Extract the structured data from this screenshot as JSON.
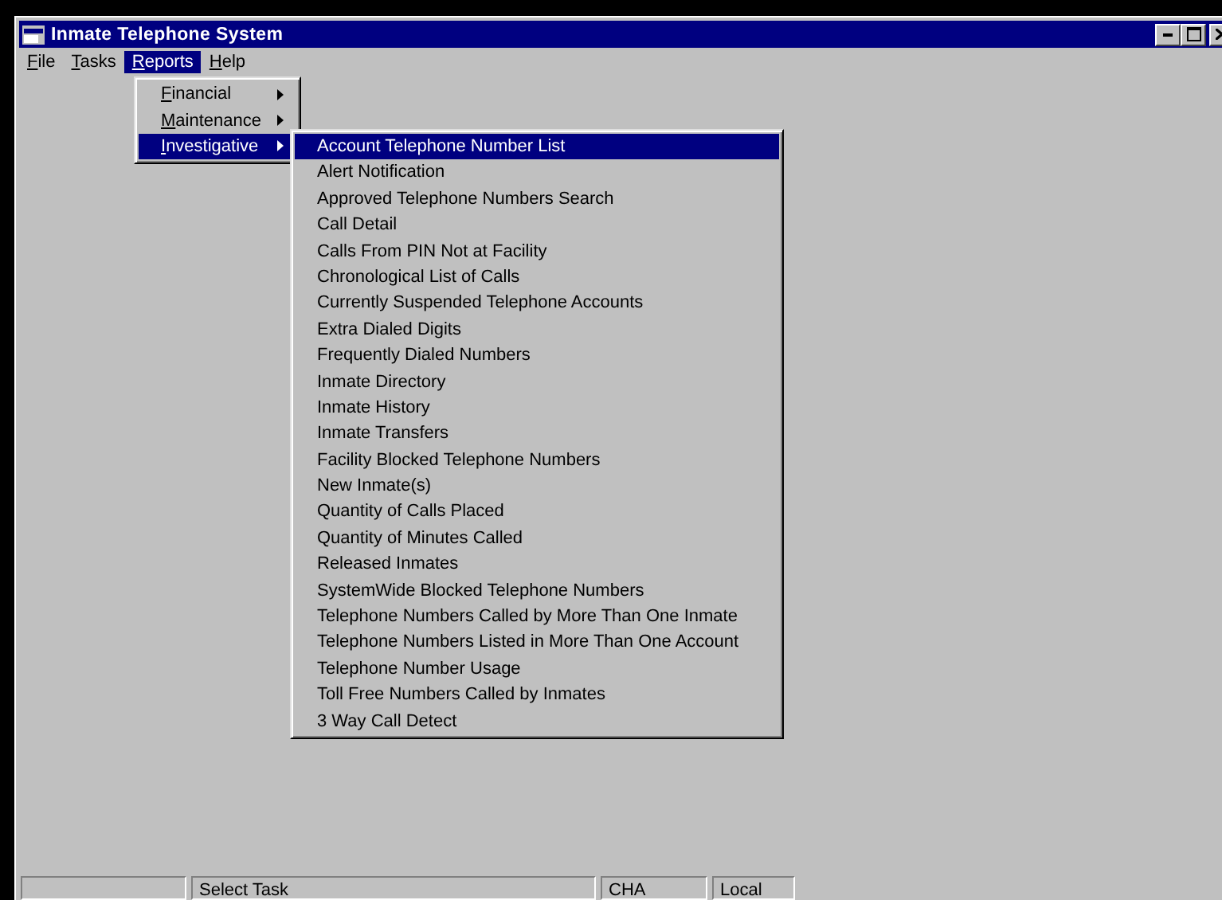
{
  "window": {
    "title": "Inmate Telephone System"
  },
  "menu_bar": [
    {
      "label": "File",
      "selected": false
    },
    {
      "label": "Tasks",
      "selected": false
    },
    {
      "label": "Reports",
      "selected": true
    },
    {
      "label": "Help",
      "selected": false
    }
  ],
  "reports_menu": [
    {
      "label": "Financial",
      "selected": false
    },
    {
      "label": "Maintenance",
      "selected": false
    },
    {
      "label": "Investigative",
      "selected": true
    }
  ],
  "investigative_menu": [
    {
      "label": "Account Telephone Number List",
      "selected": true
    },
    {
      "label": "Alert Notification",
      "selected": false
    },
    {
      "label": "Approved Telephone Numbers Search",
      "selected": false
    },
    {
      "label": "Call Detail",
      "selected": false
    },
    {
      "label": "Calls From PIN Not at Facility",
      "selected": false
    },
    {
      "label": "Chronological List of Calls",
      "selected": false
    },
    {
      "label": "Currently Suspended Telephone Accounts",
      "selected": false
    },
    {
      "label": "Extra Dialed Digits",
      "selected": false
    },
    {
      "label": "Frequently Dialed Numbers",
      "selected": false
    },
    {
      "label": "Inmate Directory",
      "selected": false
    },
    {
      "label": "Inmate History",
      "selected": false
    },
    {
      "label": "Inmate Transfers",
      "selected": false
    },
    {
      "label": "Facility Blocked Telephone Numbers",
      "selected": false
    },
    {
      "label": "New Inmate(s)",
      "selected": false
    },
    {
      "label": "Quantity of Calls Placed",
      "selected": false
    },
    {
      "label": "Quantity of Minutes Called",
      "selected": false
    },
    {
      "label": "Released Inmates",
      "selected": false
    },
    {
      "label": "SystemWide Blocked Telephone Numbers",
      "selected": false
    },
    {
      "label": "Telephone Numbers Called by More Than One Inmate",
      "selected": false
    },
    {
      "label": "Telephone Numbers Listed in More Than One Account",
      "selected": false
    },
    {
      "label": "Telephone Number Usage",
      "selected": false
    },
    {
      "label": "Toll Free Numbers Called by Inmates",
      "selected": false
    },
    {
      "label": "3 Way Call Detect",
      "selected": false
    }
  ],
  "status_bar": [
    "Select Task",
    "CHA",
    "Local"
  ]
}
